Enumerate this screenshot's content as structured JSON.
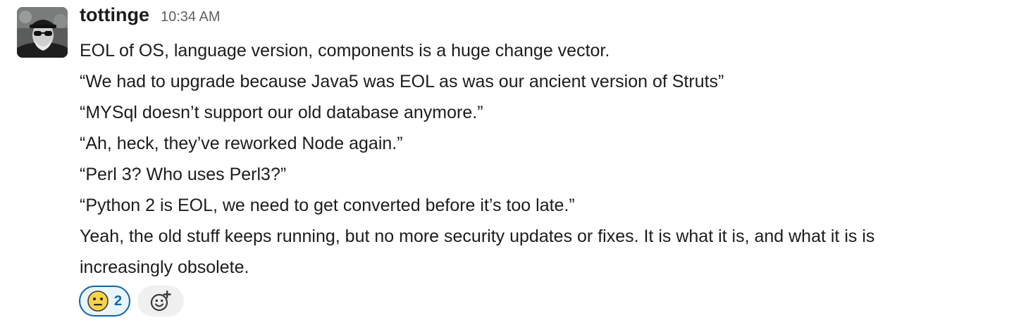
{
  "message": {
    "author": "tottinge",
    "timestamp": "10:34 AM",
    "lines": [
      "EOL of OS, language version, components is a huge change vector.",
      "“We had to upgrade because Java5 was EOL as was our ancient version of Struts”",
      "“MYSql doesn’t support our old database anymore.”",
      "“Ah, heck, they’ve reworked Node again.”",
      "“Perl 3? Who uses Perl3?”",
      "“Python 2 is EOL, we need to get converted before it’s too late.”",
      "Yeah, the old stuff keeps running, but no more security updates or fixes. It is what it is, and what it is is",
      "increasingly obsolete."
    ]
  },
  "reactions": [
    {
      "emoji": "neutral-face-emoji",
      "count": "2",
      "selected": true
    }
  ],
  "add_reaction": {
    "icon": "add-reaction-icon"
  },
  "colors": {
    "reaction_border": "#1264a3",
    "reaction_bg": "#e8f5fa",
    "emoji_yellow": "#f7d347"
  }
}
